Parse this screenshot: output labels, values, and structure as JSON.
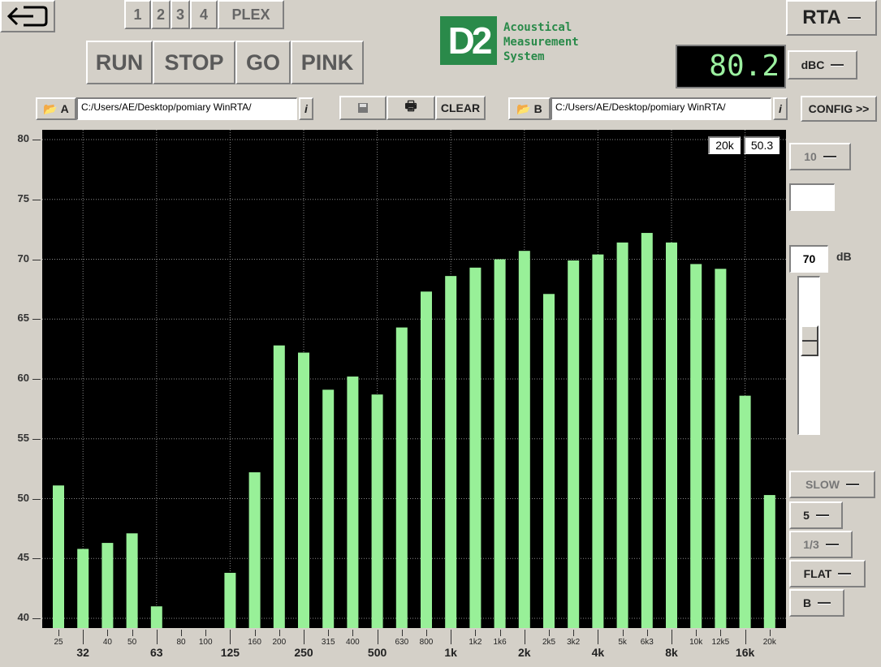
{
  "toolbar": {
    "exit_icon": "exit-icon",
    "channels": [
      "1",
      "2",
      "3",
      "4",
      "PLEX"
    ],
    "run": "RUN",
    "stop": "STOP",
    "go": "GO",
    "pink": "PINK",
    "clear": "CLEAR",
    "config": "CONFIG >>",
    "file_a_label": "A",
    "file_a_path": "C:/Users/AE/Desktop/pomiary WinRTA/",
    "file_b_label": "B",
    "file_b_path": "C:/Users/AE/Desktop/pomiary WinRTA/",
    "info": "i"
  },
  "logo": {
    "mark": "D2",
    "line1": "Acoustical",
    "line2": "Measurement",
    "line3": "System",
    "color": "#2a8a4a"
  },
  "mode": "RTA",
  "level_display": {
    "value": "80.2",
    "weighting": "dBC",
    "color": "#9cf0a0"
  },
  "cursor_readout": {
    "freq": "20k",
    "level": "50.3"
  },
  "side_panel": {
    "range": "10",
    "ref_level": "70",
    "ref_unit": "dB",
    "speed": "SLOW",
    "avg": "5",
    "bands": "1/3",
    "weight": "FLAT",
    "channel": "B",
    "slider_value": 70
  },
  "chart_data": {
    "type": "bar",
    "bar_color": "#98f098",
    "ylim": [
      40,
      80
    ],
    "yticks": [
      40,
      45,
      50,
      55,
      60,
      65,
      70,
      75,
      80
    ],
    "categories": [
      "25",
      "32",
      "40",
      "50",
      "63",
      "80",
      "100",
      "125",
      "160",
      "200",
      "250",
      "315",
      "400",
      "500",
      "630",
      "800",
      "1k",
      "1k2",
      "1k6",
      "2k",
      "2k5",
      "3k2",
      "4k",
      "5k",
      "6k3",
      "8k",
      "10k",
      "12k5",
      "16k",
      "20k"
    ],
    "major_ticks": [
      "32",
      "63",
      "125",
      "250",
      "500",
      "1k",
      "2k",
      "4k",
      "8k",
      "16k"
    ],
    "values": [
      51.1,
      45.8,
      46.3,
      47.1,
      41.0,
      null,
      null,
      43.8,
      52.2,
      62.8,
      62.2,
      59.1,
      60.2,
      58.7,
      64.3,
      67.3,
      68.6,
      69.3,
      70.0,
      70.7,
      67.1,
      69.9,
      70.4,
      71.4,
      72.2,
      71.4,
      69.6,
      69.2,
      58.6,
      50.3
    ]
  }
}
